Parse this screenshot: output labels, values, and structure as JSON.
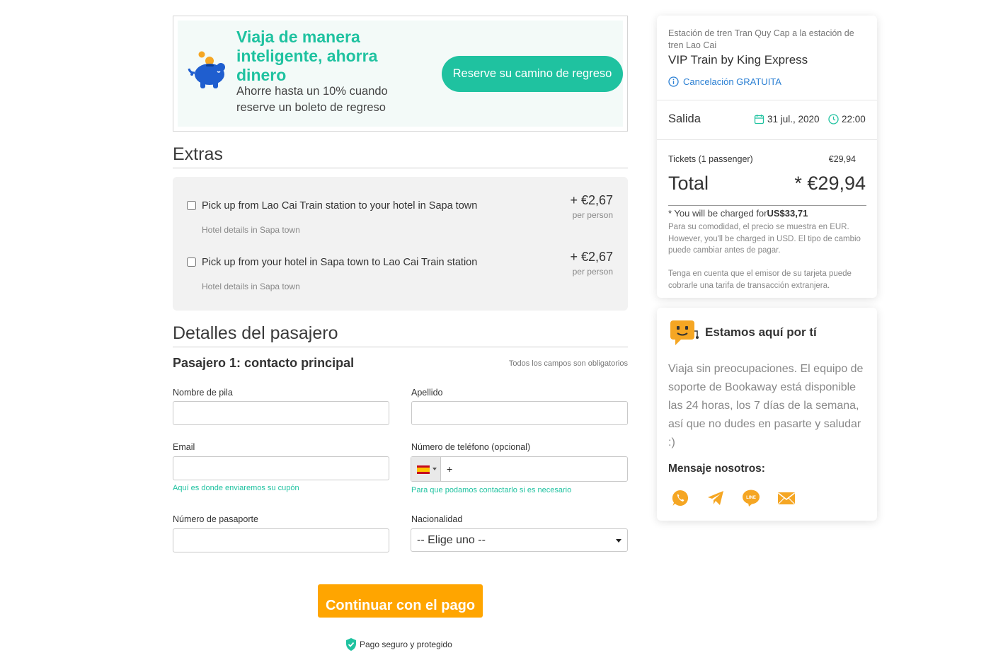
{
  "promo": {
    "title": "Viaja de manera inteligente, ahorra dinero",
    "subtitle": "Ahorre hasta un 10% cuando reserve un boleto de regreso",
    "button": "Reserve su camino de regreso"
  },
  "extras": {
    "title": "Extras",
    "items": [
      {
        "label": "Pick up from Lao Cai Train station to your hotel in Sapa town",
        "sub": "Hotel details in Sapa town",
        "price": "+ €2,67",
        "per": "per person"
      },
      {
        "label": "Pick up from your hotel in Sapa town to Lao Cai Train station",
        "sub": "Hotel details in Sapa town",
        "price": "+ €2,67",
        "per": "per person"
      }
    ]
  },
  "passenger": {
    "section_title": "Detalles del pasajero",
    "title": "Pasajero 1: contacto principal",
    "required_note": "Todos los campos son obligatorios",
    "first_name_label": "Nombre de pila",
    "last_name_label": "Apellido",
    "email_label": "Email",
    "email_help": "Aquí es donde enviaremos su cupón",
    "phone_label": "Número de teléfono (opcional)",
    "phone_prefix": "+",
    "phone_help": "Para que podamos contactarlo si es necesario",
    "passport_label": "Número de pasaporte",
    "nationality_label": "Nacionalidad",
    "nationality_value": "-- Elige uno --",
    "continue_button": "Continuar con el pago",
    "secure_text": "Pago seguro y protegido"
  },
  "summary": {
    "route": "Estación de tren Tran Quy Cap a la estación de tren Lao Cai",
    "operator": "VIP Train by King Express",
    "cancellation": "Cancelación GRATUITA",
    "departure_label": "Salida",
    "date": "31 jul., 2020",
    "time": "22:00",
    "tickets_label": "Tickets (1 passenger)",
    "tickets_price": "€29,94",
    "total_label": "Total",
    "total_value": "* €29,94",
    "charged_prefix": "* You will be charged for",
    "charged_amount": "US$33,71",
    "note1": "Para su comodidad, el precio se muestra en EUR. However, you'll be charged in USD. El tipo de cambio puede cambiar antes de pagar.",
    "note2": "Tenga en cuenta que el emisor de su tarjeta puede cobrarle una tarifa de transacción extranjera."
  },
  "support": {
    "title": "Estamos aquí por tí",
    "text": "Viaja sin preocupaciones. El equipo de soporte de Bookaway está disponible las 24 horas, los 7 días de la semana, así que no dudes en pasarte y saludar :)",
    "message_label": "Mensaje nosotros:",
    "channels": [
      "whatsapp-icon",
      "telegram-icon",
      "line-icon",
      "email-icon"
    ],
    "line_icon_text": "LINE"
  },
  "colors": {
    "accent": "#1fc2a0",
    "cta": "#ffa500",
    "link": "#2a7fd3",
    "support_icon": "#f5a623"
  }
}
